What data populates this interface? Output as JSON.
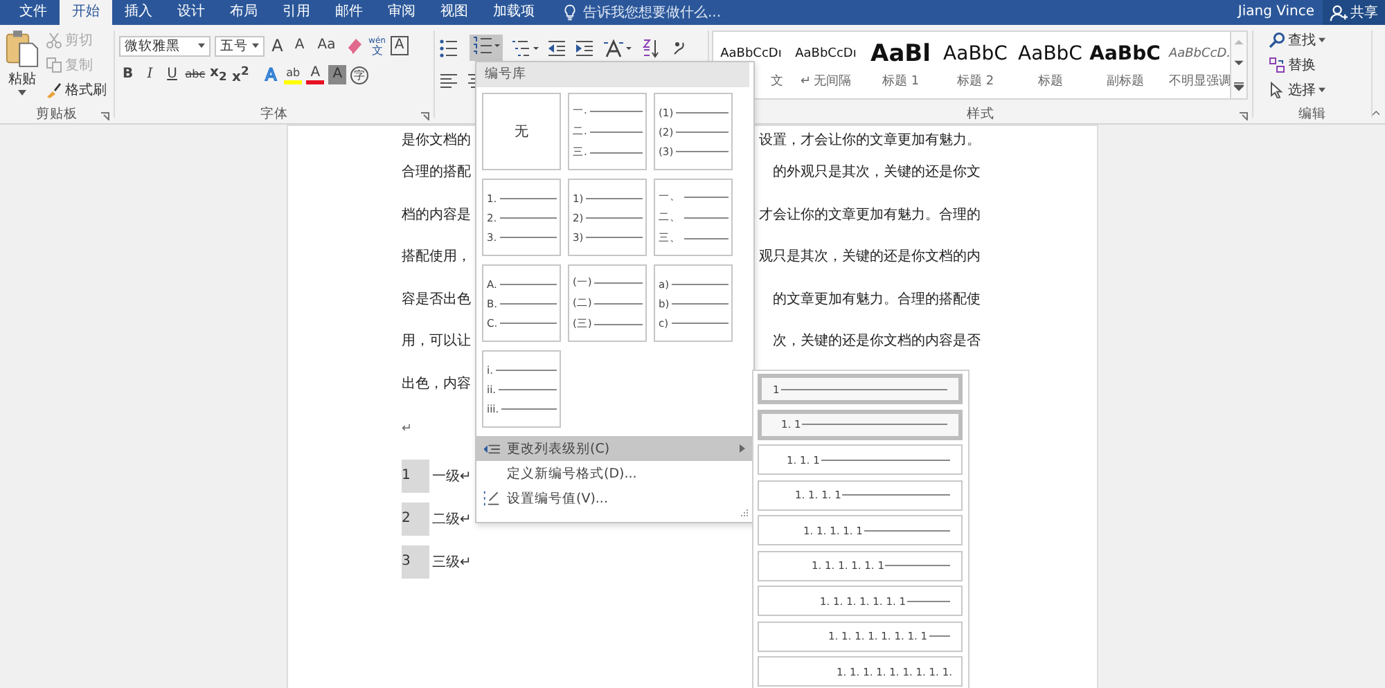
{
  "tabs": [
    {
      "label": "文件",
      "selected": false
    },
    {
      "label": "开始",
      "selected": true
    },
    {
      "label": "插入",
      "selected": false
    },
    {
      "label": "设计",
      "selected": false
    },
    {
      "label": "布局",
      "selected": false
    },
    {
      "label": "引用",
      "selected": false
    },
    {
      "label": "邮件",
      "selected": false
    },
    {
      "label": "审阅",
      "selected": false
    },
    {
      "label": "视图",
      "selected": false
    },
    {
      "label": "加载项",
      "selected": false
    }
  ],
  "tell_me": {
    "placeholder": "告诉我您想要做什么..."
  },
  "user": "Jiang Vince",
  "share": "共享",
  "clipboard": {
    "label": "剪贴板",
    "paste": "粘贴",
    "items": [
      {
        "label": "剪切",
        "kind": "cut",
        "disabled": true
      },
      {
        "label": "复制",
        "kind": "copy",
        "disabled": true
      },
      {
        "label": "格式刷",
        "kind": "painter",
        "disabled": false
      }
    ]
  },
  "font": {
    "label": "字体",
    "family": "微软雅黑",
    "size": "五号",
    "row1": [
      {
        "kind": "grow",
        "label": "A"
      },
      {
        "kind": "shrink",
        "label": "A"
      },
      {
        "kind": "case",
        "label": "Aa"
      },
      {
        "kind": "clear"
      },
      {
        "kind": "phonetic",
        "top": "wén",
        "label": "文"
      },
      {
        "kind": "border",
        "label": "A"
      }
    ],
    "row2": [
      {
        "kind": "bold",
        "label": "B"
      },
      {
        "kind": "italic",
        "label": "I"
      },
      {
        "kind": "underline",
        "label": "U"
      },
      {
        "kind": "strike",
        "label": "abc"
      },
      {
        "kind": "script",
        "label": "x$_{2}$"
      },
      {
        "kind": "script",
        "label": "x$^{2}$"
      },
      {
        "kind": "effect",
        "label": "A"
      },
      {
        "kind": "highlight",
        "label": "ab",
        "color": "#ffff00"
      },
      {
        "kind": "color",
        "label": "A",
        "color": "#e81123"
      },
      {
        "kind": "shade",
        "label": "A"
      },
      {
        "kind": "enclose",
        "label": "字"
      }
    ]
  },
  "paragraph": {
    "numbering_open": true
  },
  "styles": {
    "label": "样式",
    "items": [
      {
        "preview": "AaBbCcDı",
        "label": "文",
        "kind": "normal"
      },
      {
        "preview": "AaBbCcDı",
        "label": "无间隔",
        "kind": "normal",
        "mark": "↵"
      },
      {
        "preview": "AaBl",
        "label": "标题 1",
        "kind": "heading1"
      },
      {
        "preview": "AaBbC",
        "label": "标题 2",
        "kind": "heading2"
      },
      {
        "preview": "AaBbC",
        "label": "标题",
        "kind": "title"
      },
      {
        "preview": "AaBbC",
        "label": "副标题",
        "kind": "subtitle"
      },
      {
        "preview": "AaBbCcD.",
        "label": "不明显强调",
        "kind": "emphasis"
      }
    ]
  },
  "editing": {
    "label": "编辑",
    "items": [
      {
        "label": "查找",
        "kind": "find",
        "menu": true
      },
      {
        "label": "替换",
        "kind": "replace",
        "menu": false
      },
      {
        "label": "选择",
        "kind": "select",
        "menu": true
      }
    ]
  },
  "document": {
    "lines": [
      {
        "left": "是你文档的",
        "right": "设置，才会让你的文章更加有魅力。"
      },
      {
        "left": "合理的搭配",
        "right": "的外观只是其次，关键的还是你文"
      },
      {
        "left": "档的内容是",
        "right": "才会让你的文章更加有魅力。合理的"
      },
      {
        "left": "搭配使用，",
        "right": "观只是其次，关键的还是你文档的内"
      },
      {
        "left": "容是否出色",
        "right": "的文章更加有魅力。合理的搭配使"
      },
      {
        "left": "用，可以让",
        "right": "次，关键的还是你文档的内容是否"
      },
      {
        "left": "出色，内容"
      }
    ],
    "blank": "↵",
    "list": [
      {
        "number": "1",
        "text": "一级↵"
      },
      {
        "number": "2",
        "text": "二级↵"
      },
      {
        "number": "3",
        "text": "三级↵"
      }
    ]
  },
  "numbering_menu": {
    "title": "编号库",
    "tiles": [
      {
        "kind": "none",
        "label": "无"
      },
      {
        "kind": "list",
        "items": [
          "一.",
          "二.",
          "三."
        ]
      },
      {
        "kind": "list",
        "items": [
          "(1)",
          "(2)",
          "(3)"
        ]
      },
      {
        "kind": "list",
        "items": [
          "1.",
          "2.",
          "3."
        ]
      },
      {
        "kind": "list",
        "items": [
          "1)",
          "2)",
          "3)"
        ]
      },
      {
        "kind": "list",
        "items": [
          "一、",
          "二、",
          "三、"
        ]
      },
      {
        "kind": "list",
        "items": [
          "A.",
          "B.",
          "C."
        ]
      },
      {
        "kind": "list",
        "items": [
          "(一)",
          "(二)",
          "(三)"
        ]
      },
      {
        "kind": "list",
        "items": [
          "a)",
          "b)",
          "c)"
        ]
      },
      {
        "kind": "list",
        "items": [
          "i.",
          "ii.",
          "iii."
        ]
      }
    ],
    "commands": [
      {
        "label": "更改列表级别(C)",
        "kind": "level",
        "selected": true,
        "submenu": true
      },
      {
        "label": "定义新编号格式(D)...",
        "kind": "define",
        "selected": false,
        "submenu": false
      },
      {
        "label": "设置编号值(V)...",
        "kind": "value",
        "selected": false,
        "submenu": false
      }
    ]
  },
  "level_menu": {
    "items": [
      {
        "label": "1",
        "selected": true
      },
      {
        "label": "1. 1",
        "selected": true
      },
      {
        "label": "1. 1. 1",
        "selected": false
      },
      {
        "label": "1. 1. 1. 1",
        "selected": false
      },
      {
        "label": "1. 1. 1. 1. 1",
        "selected": false
      },
      {
        "label": "1. 1. 1. 1. 1. 1",
        "selected": false
      },
      {
        "label": "1. 1. 1. 1. 1. 1. 1",
        "selected": false
      },
      {
        "label": "1. 1. 1. 1. 1. 1. 1. 1",
        "selected": false
      },
      {
        "label": "1. 1. 1. 1. 1. 1. 1. 1. 1.",
        "selected": false
      }
    ]
  }
}
